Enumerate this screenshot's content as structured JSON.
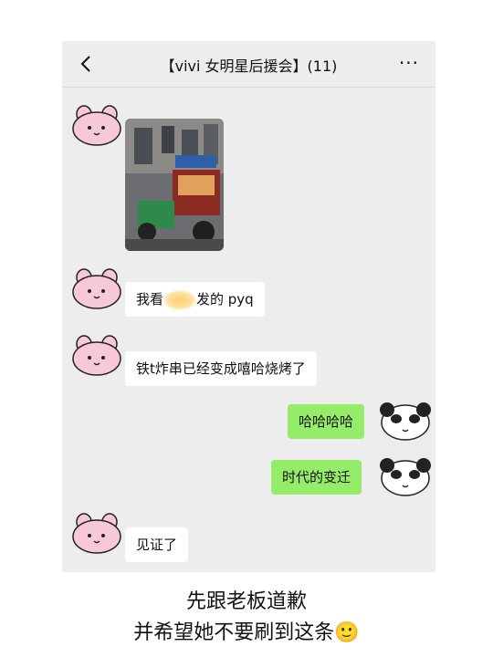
{
  "chat": {
    "title": "【vivi 女明星后援会】(11)",
    "more": "···"
  },
  "messages": {
    "m2_pre": "我看",
    "m2_post": "发的 pyq",
    "m3": "铁t炸串已经变成嘻哈烧烤了",
    "m4": "哈哈哈哈",
    "m5": "时代的变迁",
    "m6": "见证了"
  },
  "caption": {
    "line1": "先跟老板道歉",
    "line2": "并希望她不要刷到这条🙂"
  },
  "colors": {
    "chat_bg": "#ededed",
    "sent_bubble": "#95ec69",
    "received_bubble": "#ffffff",
    "avatar_pink": "#f7c9d6"
  }
}
